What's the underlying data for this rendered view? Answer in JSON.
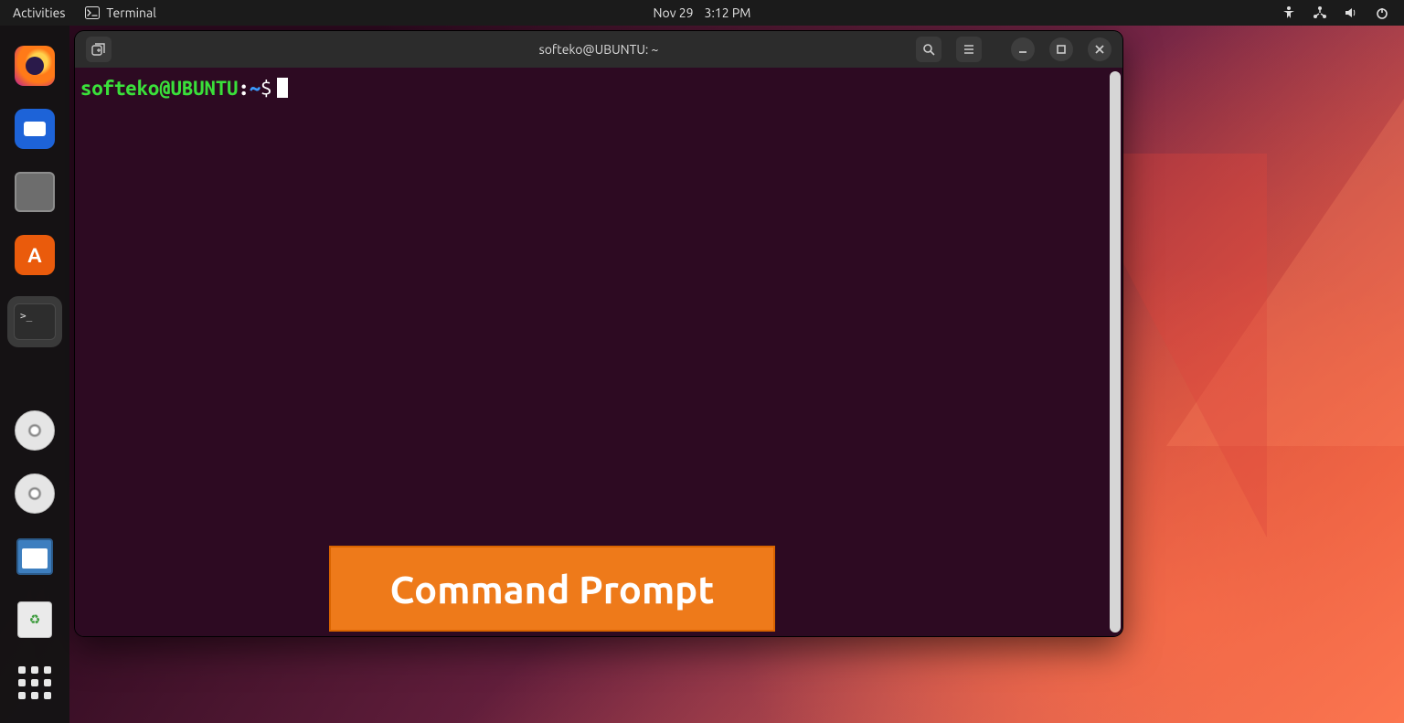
{
  "panel": {
    "activities": "Activities",
    "app_name": "Terminal",
    "date": "Nov 29",
    "time": "3:12 PM"
  },
  "dock": {
    "firefox": "Firefox",
    "thunderbird": "Thunderbird",
    "files": "Files",
    "software": "Ubuntu Software",
    "terminal": "Terminal",
    "terminal_glyph": ">_",
    "disc1": "Disc",
    "disc2": "Disc",
    "save": "Save",
    "trash": "Trash",
    "apps": "Show Applications",
    "store_letter": "A"
  },
  "window": {
    "title": "softeko@UBUNTU: ~",
    "prompt_user": "softeko",
    "prompt_at": "@",
    "prompt_host": "UBUNTU",
    "prompt_colon": ":",
    "prompt_path": "~",
    "prompt_symbol": "$"
  },
  "callout": {
    "text": "Command Prompt"
  }
}
